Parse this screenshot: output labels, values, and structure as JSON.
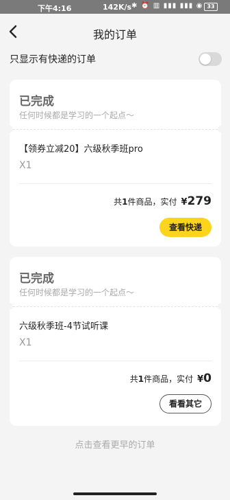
{
  "status_bar": {
    "time": "下午4:16",
    "speed": "142K/s",
    "icons": "✱ ⏰ ▥ ▮▮▮ ▮▮▮ ◉",
    "battery": "33"
  },
  "header": {
    "title": "我的订单",
    "back_icon": "chevron-left-icon"
  },
  "filter": {
    "label": "只显示有快递的订单",
    "toggle_on": false
  },
  "orders": [
    {
      "status": "已完成",
      "slogan": "任何时候都是学习的一个起点～",
      "product": "【领券立减20】六级秋季班pro",
      "quantity": "X1",
      "summary_prefix": "共",
      "item_count": "1",
      "summary_suffix": "件商品，实付",
      "currency": "¥",
      "price": "279",
      "action_label": "查看快递"
    },
    {
      "status": "已完成",
      "slogan": "任何时候都是学习的一个起点～",
      "product": "六级秋季班-4节试听课",
      "quantity": "X1",
      "summary_prefix": "共",
      "item_count": "1",
      "summary_suffix": "件商品，实付",
      "currency": "¥",
      "price": "0",
      "action_label": "看看其它"
    }
  ],
  "footer": {
    "more_link": "点击查看更早的订单"
  },
  "colors": {
    "accent": "#fbd51d",
    "background": "#f4f4f4"
  }
}
